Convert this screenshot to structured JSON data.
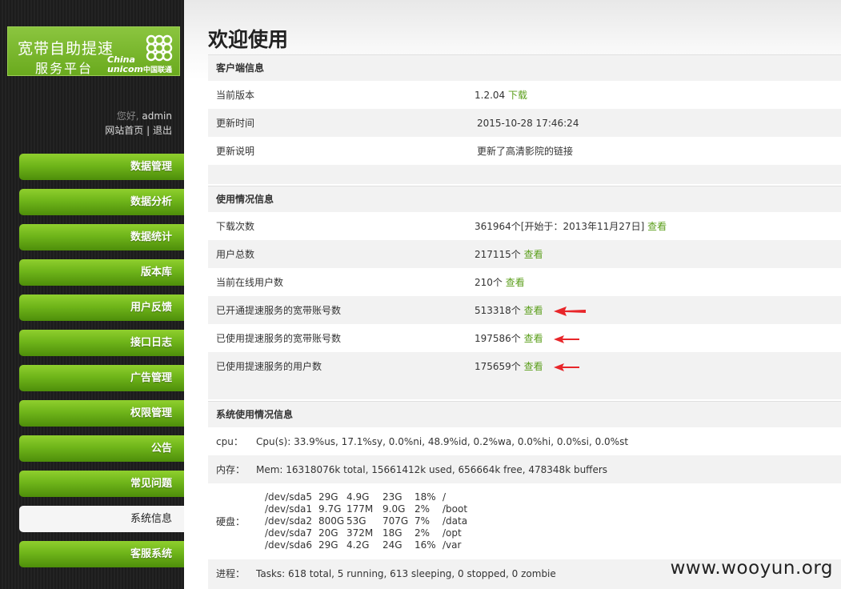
{
  "logo": {
    "line1": "宽带自助提速",
    "line2": "服务平台",
    "brand_en1": "China",
    "brand_en2": "unicom",
    "brand_cn": "中国联通"
  },
  "user": {
    "greeting": "您好,",
    "name": "admin",
    "home_link": "网站首页",
    "separator": "|",
    "logout_link": "退出"
  },
  "nav": [
    {
      "label": "数据管理"
    },
    {
      "label": "数据分析"
    },
    {
      "label": "数据统计"
    },
    {
      "label": "版本库"
    },
    {
      "label": "用户反馈"
    },
    {
      "label": "接口日志"
    },
    {
      "label": "广告管理"
    },
    {
      "label": "权限管理"
    },
    {
      "label": "公告"
    },
    {
      "label": "常见问题"
    },
    {
      "label": "系统信息",
      "active": true
    },
    {
      "label": "客服系统"
    }
  ],
  "page_title": "欢迎使用",
  "client_info": {
    "title": "客户端信息",
    "version_label": "当前版本",
    "version_value": "1.2.04",
    "version_link": "下载",
    "updated_label": "更新时间",
    "updated_value": "2015-10-28 17:46:24",
    "notes_label": "更新说明",
    "notes_value": "更新了高清影院的链接"
  },
  "usage_info": {
    "title": "使用情况信息",
    "rows": [
      {
        "label": "下载次数",
        "value": "361964个[开始于：2013年11月27日]",
        "link": "查看",
        "arrow": false
      },
      {
        "label": "用户总数",
        "value": "217115个",
        "link": "查看",
        "arrow": false
      },
      {
        "label": "当前在线用户数",
        "value": "210个",
        "link": "查看",
        "arrow": false
      },
      {
        "label": "已开通提速服务的宽带账号数",
        "value": "513318个",
        "link": "查看",
        "arrow": true
      },
      {
        "label": "已使用提速服务的宽带账号数",
        "value": "197586个",
        "link": "查看",
        "arrow": true
      },
      {
        "label": "已使用提速服务的用户数",
        "value": "175659个",
        "link": "查看",
        "arrow": true
      }
    ]
  },
  "system_info": {
    "title": "系统使用情况信息",
    "cpu_label": "cpu：",
    "cpu_value": "Cpu(s): 33.9%us, 17.1%sy, 0.0%ni, 48.9%id, 0.2%wa, 0.0%hi, 0.0%si, 0.0%st",
    "mem_label": "内存：",
    "mem_value": "Mem: 16318076k total, 15661412k used, 656664k free, 478348k buffers",
    "disk_label": "硬盘：",
    "disks": [
      [
        "/dev/sda5",
        "29G",
        "4.9G",
        "23G",
        "18%",
        "/"
      ],
      [
        "/dev/sda1",
        "9.7G",
        "177M",
        "9.0G",
        "2%",
        "/boot"
      ],
      [
        "/dev/sda2",
        "800G",
        "53G",
        "707G",
        "7%",
        "/data"
      ],
      [
        "/dev/sda7",
        "20G",
        "372M",
        "18G",
        "2%",
        "/opt"
      ],
      [
        "/dev/sda6",
        "29G",
        "4.2G",
        "24G",
        "16%",
        "/var"
      ]
    ],
    "proc_label": "进程：",
    "proc_value": "Tasks: 618 total, 5 running, 613 sleeping, 0 stopped, 0 zombie"
  },
  "watermark": "www.wooyun.org",
  "colors": {
    "accent_green": "#6fb51a",
    "link_green": "#5a9e1a",
    "arrow_red": "#e8262a"
  }
}
